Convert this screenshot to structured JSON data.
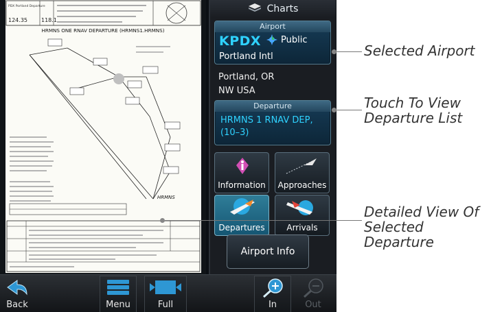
{
  "chart": {
    "header_left_top": "PDX Portland Departure",
    "freq_1": "124.35",
    "freq_2": "118.1",
    "procedure_title": "HRMNS ONE RNAV DEPARTURE (HRMNS1.HRMNS)",
    "fix_label": "HRMNS"
  },
  "panel": {
    "title": "Charts",
    "airport": {
      "header": "Airport",
      "code": "KPDX",
      "type": "Public",
      "name": "Portland Intl",
      "location_line1": "Portland, OR",
      "location_line2": "NW USA"
    },
    "departure": {
      "header": "Departure",
      "value_line1": "HRMNS 1 RNAV DEP,",
      "value_line2": "(10–3)"
    },
    "tiles": [
      {
        "label": "Information"
      },
      {
        "label": "Approaches"
      },
      {
        "label": "Departures"
      },
      {
        "label": "Arrivals"
      }
    ],
    "airport_info_label": "Airport Info"
  },
  "softkeys": {
    "back": "Back",
    "menu": "Menu",
    "full": "Full",
    "zoom_in": "In",
    "zoom_out": "Out"
  },
  "callouts": {
    "selected_airport": "Selected Airport",
    "touch_line1": "Touch To View",
    "touch_line2": "Departure List",
    "detail_line1": "Detailed View Of",
    "detail_line2": "Selected Departure"
  },
  "colors": {
    "accent_cyan": "#2fd2ff",
    "active_tile": "#2f7d98",
    "icon_magenta": "#d14fb4"
  }
}
